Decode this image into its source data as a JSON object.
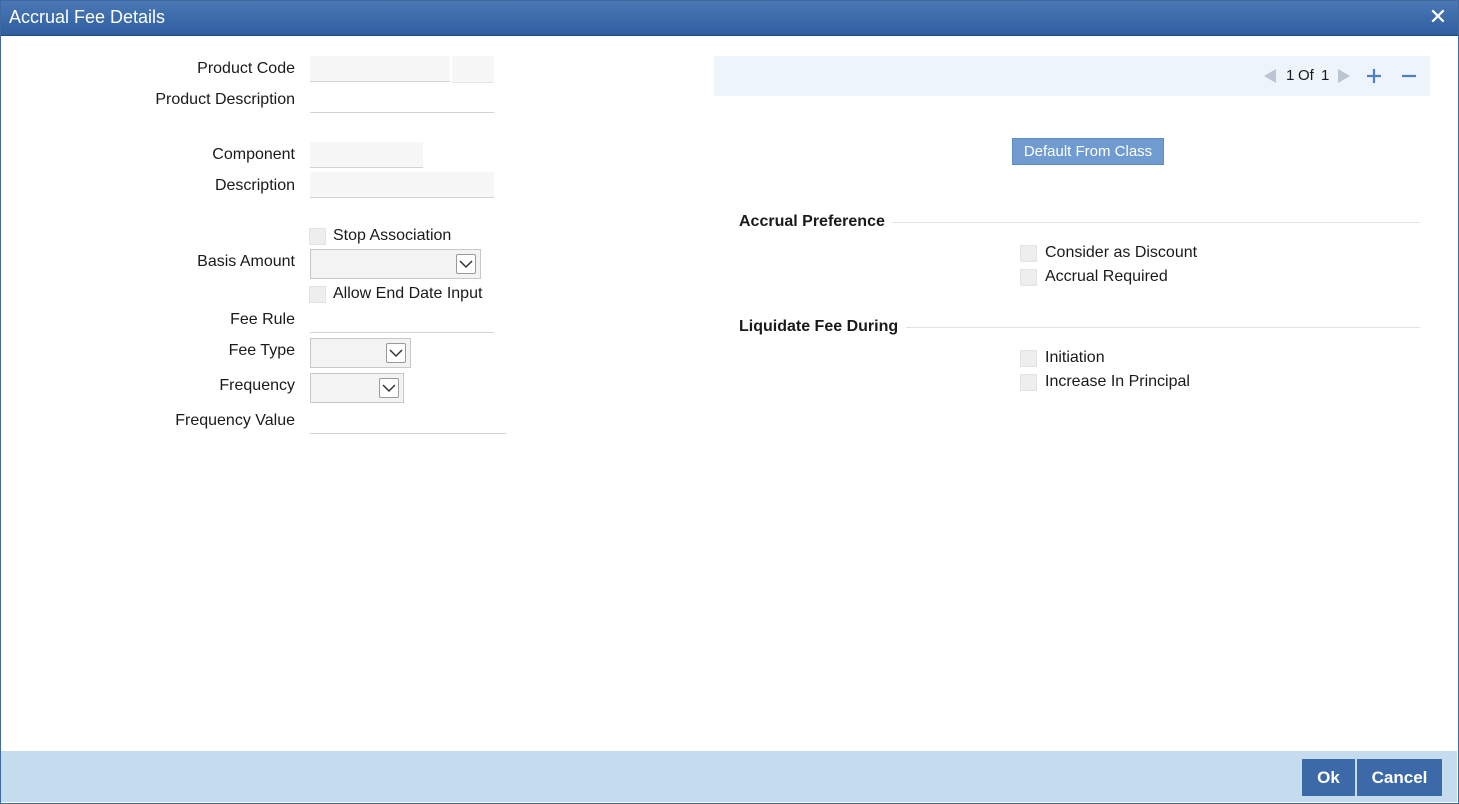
{
  "window": {
    "title": "Accrual Fee Details"
  },
  "form": {
    "product_code": {
      "label": "Product Code",
      "value": ""
    },
    "product_description": {
      "label": "Product Description",
      "value": ""
    },
    "component": {
      "label": "Component",
      "value": ""
    },
    "description": {
      "label": "Description",
      "value": ""
    },
    "stop_association": {
      "label": "Stop Association",
      "checked": false
    },
    "basis_amount": {
      "label": "Basis Amount",
      "value": ""
    },
    "allow_end_date_input": {
      "label": "Allow End Date Input",
      "checked": false
    },
    "fee_rule": {
      "label": "Fee Rule",
      "value": ""
    },
    "fee_type": {
      "label": "Fee Type",
      "value": ""
    },
    "frequency": {
      "label": "Frequency",
      "value": ""
    },
    "frequency_value": {
      "label": "Frequency Value",
      "value": ""
    }
  },
  "pager": {
    "current": "1",
    "of_label": "Of",
    "total": "1"
  },
  "actions": {
    "default_from_class": "Default From Class"
  },
  "accrual_preference": {
    "title": "Accrual Preference",
    "consider_as_discount": {
      "label": "Consider as Discount",
      "checked": false
    },
    "accrual_required": {
      "label": "Accrual Required",
      "checked": false
    }
  },
  "liquidate_fee_during": {
    "title": "Liquidate Fee During",
    "initiation": {
      "label": "Initiation",
      "checked": false
    },
    "increase_in_principal": {
      "label": "Increase In Principal",
      "checked": false
    }
  },
  "footer": {
    "ok": "Ok",
    "cancel": "Cancel"
  },
  "colors": {
    "titlebar": "#3a6aa8",
    "accent_button": "#6f9bd0",
    "footer_bg": "#c4dcee",
    "footer_button": "#3c6aa8"
  }
}
